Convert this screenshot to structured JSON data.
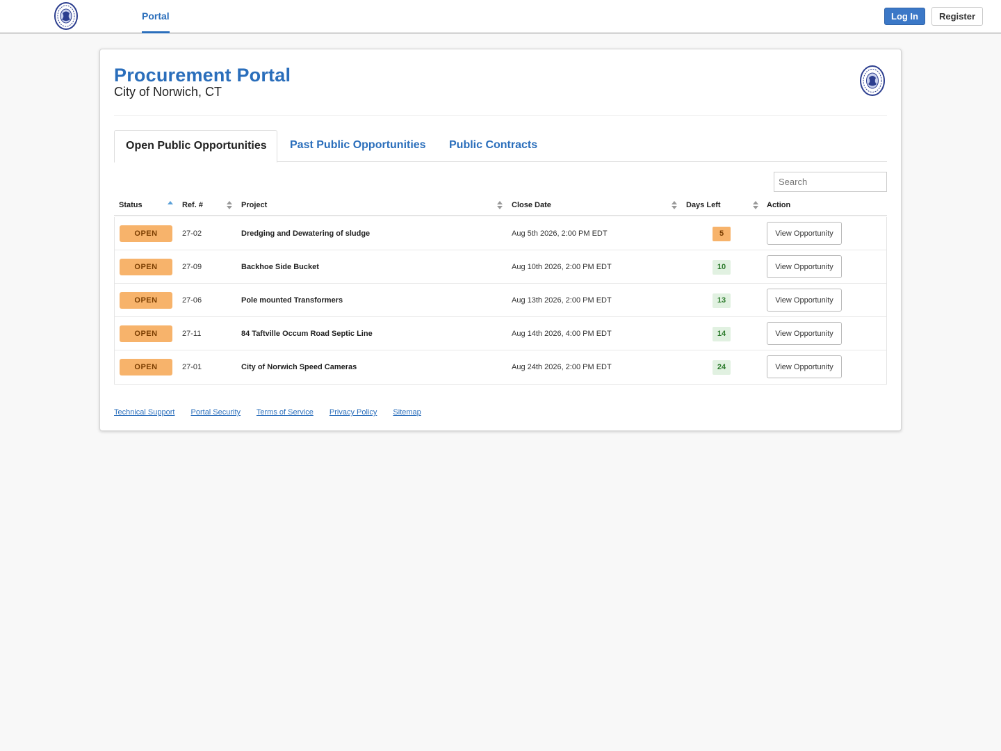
{
  "nav": {
    "portal_label": "Portal",
    "login_label": "Log In",
    "register_label": "Register"
  },
  "header": {
    "title": "Procurement Portal",
    "subtitle": "City of Norwich, CT"
  },
  "tabs": [
    {
      "label": "Open Public Opportunities",
      "active": true
    },
    {
      "label": "Past Public Opportunities",
      "active": false
    },
    {
      "label": "Public Contracts",
      "active": false
    }
  ],
  "search": {
    "placeholder": "Search",
    "value": ""
  },
  "table": {
    "columns": [
      "Status",
      "Ref. #",
      "Project",
      "Close Date",
      "Days Left",
      "Action"
    ],
    "rows": [
      {
        "status": "OPEN",
        "ref": "27-02",
        "project": "Dredging and Dewatering of sludge",
        "close_date": "Aug 5th 2026, 2:00 PM EDT",
        "days_left": "5",
        "action": "View Opportunity"
      },
      {
        "status": "OPEN",
        "ref": "27-09",
        "project": "Backhoe Side Bucket",
        "close_date": "Aug 10th 2026, 2:00 PM EDT",
        "days_left": "10",
        "action": "View Opportunity"
      },
      {
        "status": "OPEN",
        "ref": "27-06",
        "project": "Pole mounted Transformers",
        "close_date": "Aug 13th 2026, 2:00 PM EDT",
        "days_left": "13",
        "action": "View Opportunity"
      },
      {
        "status": "OPEN",
        "ref": "27-11",
        "project": "84 Taftville Occum Road Septic Line",
        "close_date": "Aug 14th 2026, 4:00 PM EDT",
        "days_left": "14",
        "action": "View Opportunity"
      },
      {
        "status": "OPEN",
        "ref": "27-01",
        "project": "City of Norwich Speed Cameras",
        "close_date": "Aug 24th 2026, 2:00 PM EDT",
        "days_left": "24",
        "action": "View Opportunity"
      }
    ]
  },
  "footer": {
    "links": [
      "Technical Support",
      "Portal Security",
      "Terms of Service",
      "Privacy Policy",
      "Sitemap"
    ]
  },
  "colors": {
    "accent": "#2a6ebb",
    "open_badge": "#f7b36b",
    "days_ok": "#e1f1e1"
  },
  "icons": {
    "logo": "city-seal-icon"
  }
}
